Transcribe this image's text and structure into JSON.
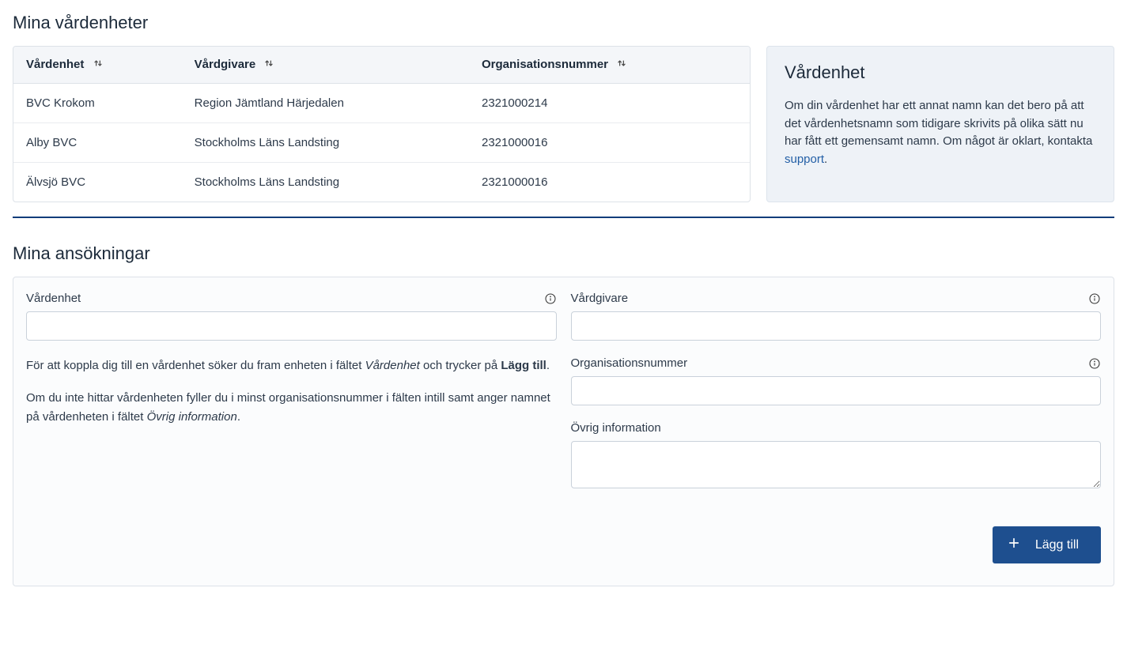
{
  "section1": {
    "title": "Mina vårdenheter",
    "columns": {
      "unit": "Vårdenhet",
      "provider": "Vårdgivare",
      "orgnr": "Organisationsnummer"
    },
    "rows": [
      {
        "unit": "BVC Krokom",
        "provider": "Region Jämtland Härjedalen",
        "orgnr": "2321000214"
      },
      {
        "unit": "Alby BVC",
        "provider": "Stockholms Läns Landsting",
        "orgnr": "2321000016"
      },
      {
        "unit": "Älvsjö BVC",
        "provider": "Stockholms Läns Landsting",
        "orgnr": "2321000016"
      }
    ],
    "panel": {
      "title": "Vårdenhet",
      "text_before_link": "Om din vårdenhet har ett annat namn kan det bero på att det vårdenhetsnamn som tidigare skrivits på olika sätt nu har fått ett gemensamt namn. Om något är oklart, kontakta ",
      "link_text": "support",
      "text_after_link": "."
    }
  },
  "section2": {
    "title": "Mina ansökningar",
    "labels": {
      "unit": "Vårdenhet",
      "provider": "Vårdgivare",
      "orgnr": "Organisationsnummer",
      "other": "Övrig information"
    },
    "values": {
      "unit": "",
      "provider": "",
      "orgnr": "",
      "other": ""
    },
    "help": {
      "p1_prefix": "För att koppla dig till en vårdenhet söker du fram enheten i fältet ",
      "p1_em": "Vårdenhet",
      "p1_mid": " och trycker på ",
      "p1_strong": "Lägg till",
      "p1_suffix": ".",
      "p2_prefix": "Om du inte hittar vårdenheten fyller du i minst organisationsnummer i fälten intill samt anger namnet på vårdenheten i fältet ",
      "p2_em": "Övrig information",
      "p2_suffix": "."
    },
    "button": "Lägg till"
  }
}
